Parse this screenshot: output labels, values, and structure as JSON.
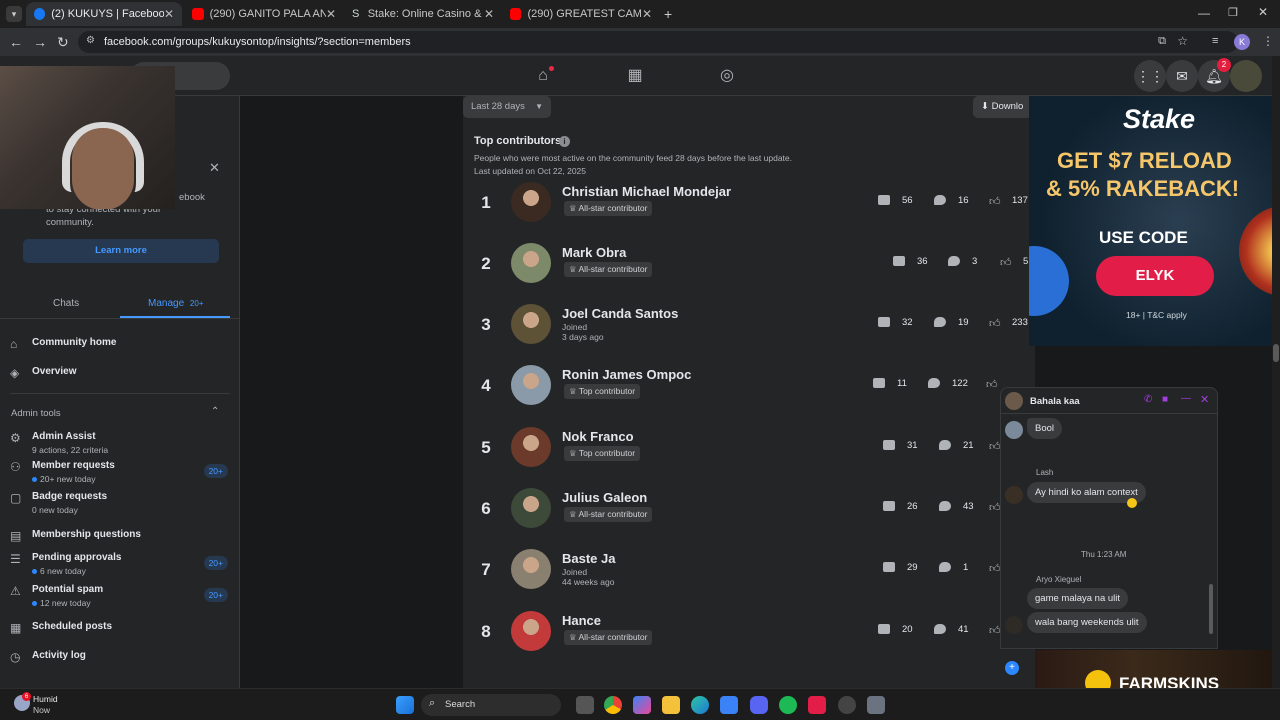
{
  "browser": {
    "tabs": [
      {
        "title": "(2) KUKUYS | Facebook",
        "active": true,
        "favicon_color": "#1877f2"
      },
      {
        "title": "(290) GANITO PALA ANG GABI",
        "active": false,
        "favicon_color": "#ff0000"
      },
      {
        "title": "Stake: Online Casino & Sports B",
        "active": false,
        "favicon_color": "#cfd8dc"
      },
      {
        "title": "(290) GREATEST CAMPING ADV",
        "active": false,
        "favicon_color": "#ff0000"
      }
    ],
    "new_tab": "+",
    "url": "facebook.com/groups/kukuysontop/insights/?section=members",
    "profile_initial": "K"
  },
  "fb_header": {
    "notification_count": "2"
  },
  "sidebar": {
    "promo_text_1": "ebook",
    "promo_text_2": "to stay connected with your",
    "promo_text_3": "community.",
    "learn_more": "Learn more",
    "tabs": {
      "chats": "Chats",
      "manage": "Manage",
      "manage_badge": "20+"
    },
    "community_home": "Community home",
    "overview": "Overview",
    "admin_tools": "Admin tools",
    "items": [
      {
        "label": "Admin Assist",
        "sub": "9 actions, 22 criteria",
        "badge": "",
        "dot": false
      },
      {
        "label": "Member requests",
        "sub": "20+ new today",
        "badge": "20+",
        "dot": true
      },
      {
        "label": "Badge requests",
        "sub": "0 new today",
        "badge": "",
        "dot": false
      },
      {
        "label": "Membership questions",
        "sub": "",
        "badge": "",
        "dot": false
      },
      {
        "label": "Pending approvals",
        "sub": "6 new today",
        "badge": "20+",
        "dot": true
      },
      {
        "label": "Potential spam",
        "sub": "12 new today",
        "badge": "20+",
        "dot": true
      },
      {
        "label": "Scheduled posts",
        "sub": "",
        "badge": "",
        "dot": false
      },
      {
        "label": "Activity log",
        "sub": "",
        "badge": "",
        "dot": false
      }
    ]
  },
  "main": {
    "range_select": "Last 28 days",
    "download": "Downlo",
    "section_title": "Top contributors",
    "description": "People who were most active on the community feed 28 days before the last update.",
    "last_updated": "Last updated on Oct 22, 2025",
    "contributors": [
      {
        "rank": "1",
        "name": "Christian Michael Mondejar",
        "tag": "All-star contributor",
        "tag_type": "pill",
        "posts": "56",
        "comments": "16",
        "reactions": "137",
        "avatar_color": "#3a2a22"
      },
      {
        "rank": "2",
        "name": "Mark Obra",
        "tag": "All-star contributor",
        "tag_type": "pill",
        "posts": "36",
        "comments": "3",
        "reactions": "5",
        "avatar_color": "#7d8a6a"
      },
      {
        "rank": "3",
        "name": "Joel Canda Santos",
        "tag": "Joined",
        "sub": "3 days ago",
        "tag_type": "text",
        "posts": "32",
        "comments": "19",
        "reactions": "233",
        "avatar_color": "#5d5236"
      },
      {
        "rank": "4",
        "name": "Ronin James Ompoc",
        "tag": "Top contributor",
        "tag_type": "pill",
        "posts": "11",
        "comments": "122",
        "reactions": "",
        "avatar_color": "#8a9aa8"
      },
      {
        "rank": "5",
        "name": "Nok Franco",
        "tag": "Top contributor",
        "tag_type": "pill",
        "posts": "31",
        "comments": "21",
        "reactions": "",
        "avatar_color": "#6b3a2a"
      },
      {
        "rank": "6",
        "name": "Julius Galeon",
        "tag": "All-star contributor",
        "tag_type": "pill",
        "posts": "26",
        "comments": "43",
        "reactions": "",
        "avatar_color": "#3d4a3a"
      },
      {
        "rank": "7",
        "name": "Baste Ja",
        "tag": "Joined",
        "sub": "44 weeks ago",
        "tag_type": "text",
        "posts": "29",
        "comments": "1",
        "reactions": "",
        "avatar_color": "#8a8070"
      },
      {
        "rank": "8",
        "name": "Hance",
        "tag": "All-star contributor",
        "tag_type": "pill",
        "posts": "20",
        "comments": "41",
        "reactions": "",
        "avatar_color": "#c23a3a"
      }
    ]
  },
  "stake_ad": {
    "brand": "Stake",
    "headline_1": "GET $7 RELOAD",
    "headline_2": "& 5% RAKEBACK!",
    "use_code": "USE CODE",
    "code": "ELYK",
    "fine_print": "18+ | T&C apply"
  },
  "chat": {
    "title": "Bahala kaa",
    "messages": [
      {
        "sender": "",
        "text": "Bool"
      },
      {
        "sender": "Lash",
        "text": "Ay hindi ko alam context"
      },
      {
        "sender": "",
        "text": "Thu 1:23 AM",
        "kind": "timestamp"
      },
      {
        "sender": "Aryo Xieguel",
        "text": "game malaya na ulit"
      },
      {
        "sender": "",
        "text": "wala bang weekends ulit"
      }
    ]
  },
  "farmskins": {
    "brand": "FARMSKINS"
  },
  "taskbar": {
    "weather_title": "Humid",
    "weather_sub": "Now",
    "weather_badge": "6",
    "search": "Search"
  }
}
